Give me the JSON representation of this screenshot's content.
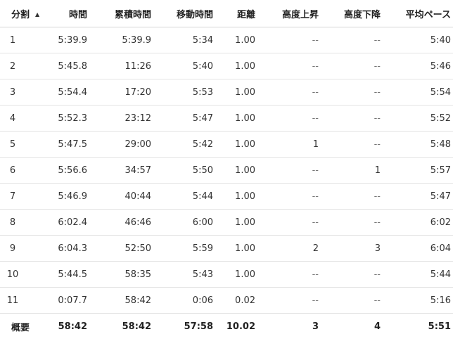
{
  "headers": {
    "split": "分割",
    "time": "時間",
    "cumulative": "累積時間",
    "moving": "移動時間",
    "distance": "距離",
    "elev_gain": "高度上昇",
    "elev_loss": "高度下降",
    "avg_pace": "平均ペース"
  },
  "sort_icon": "sort-ascending-icon",
  "rows": [
    {
      "split": "1",
      "time": "5:39.9",
      "cumulative": "5:39.9",
      "moving": "5:34",
      "distance": "1.00",
      "elev_gain": "--",
      "elev_loss": "--",
      "avg_pace": "5:40"
    },
    {
      "split": "2",
      "time": "5:45.8",
      "cumulative": "11:26",
      "moving": "5:40",
      "distance": "1.00",
      "elev_gain": "--",
      "elev_loss": "--",
      "avg_pace": "5:46"
    },
    {
      "split": "3",
      "time": "5:54.4",
      "cumulative": "17:20",
      "moving": "5:53",
      "distance": "1.00",
      "elev_gain": "--",
      "elev_loss": "--",
      "avg_pace": "5:54"
    },
    {
      "split": "4",
      "time": "5:52.3",
      "cumulative": "23:12",
      "moving": "5:47",
      "distance": "1.00",
      "elev_gain": "--",
      "elev_loss": "--",
      "avg_pace": "5:52"
    },
    {
      "split": "5",
      "time": "5:47.5",
      "cumulative": "29:00",
      "moving": "5:42",
      "distance": "1.00",
      "elev_gain": "1",
      "elev_loss": "--",
      "avg_pace": "5:48"
    },
    {
      "split": "6",
      "time": "5:56.6",
      "cumulative": "34:57",
      "moving": "5:50",
      "distance": "1.00",
      "elev_gain": "--",
      "elev_loss": "1",
      "avg_pace": "5:57"
    },
    {
      "split": "7",
      "time": "5:46.9",
      "cumulative": "40:44",
      "moving": "5:44",
      "distance": "1.00",
      "elev_gain": "--",
      "elev_loss": "--",
      "avg_pace": "5:47"
    },
    {
      "split": "8",
      "time": "6:02.4",
      "cumulative": "46:46",
      "moving": "6:00",
      "distance": "1.00",
      "elev_gain": "--",
      "elev_loss": "--",
      "avg_pace": "6:02"
    },
    {
      "split": "9",
      "time": "6:04.3",
      "cumulative": "52:50",
      "moving": "5:59",
      "distance": "1.00",
      "elev_gain": "2",
      "elev_loss": "3",
      "avg_pace": "6:04"
    },
    {
      "split": "10",
      "time": "5:44.5",
      "cumulative": "58:35",
      "moving": "5:43",
      "distance": "1.00",
      "elev_gain": "--",
      "elev_loss": "--",
      "avg_pace": "5:44"
    },
    {
      "split": "11",
      "time": "0:07.7",
      "cumulative": "58:42",
      "moving": "0:06",
      "distance": "0.02",
      "elev_gain": "--",
      "elev_loss": "--",
      "avg_pace": "5:16"
    }
  ],
  "summary": {
    "label": "概要",
    "time": "58:42",
    "cumulative": "58:42",
    "moving": "57:58",
    "distance": "10.02",
    "elev_gain": "3",
    "elev_loss": "4",
    "avg_pace": "5:51"
  }
}
